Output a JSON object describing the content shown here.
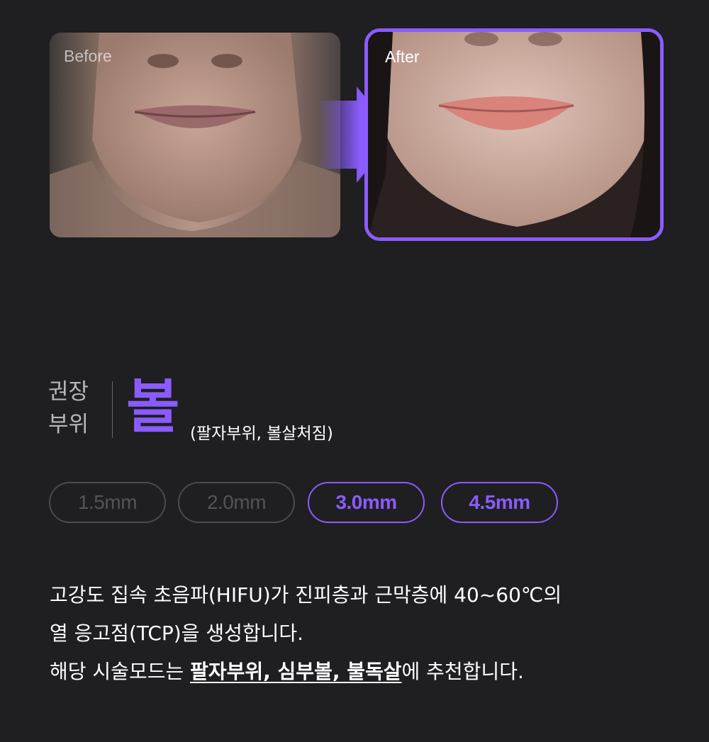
{
  "comparison": {
    "before_label": "Before",
    "after_label": "After"
  },
  "recommendation": {
    "label_line1": "권장",
    "label_line2": "부위",
    "area": "볼",
    "area_detail": "(팔자부위, 볼살처짐)"
  },
  "depths": [
    {
      "label": "1.5mm",
      "active": false
    },
    {
      "label": "2.0mm",
      "active": false
    },
    {
      "label": "3.0mm",
      "active": true
    },
    {
      "label": "4.5mm",
      "active": true
    }
  ],
  "description": {
    "line1": "고강도 집속 초음파(HIFU)가 진피층과 근막층에 40~60℃의",
    "line2": "열 응고점(TCP)을 생성합니다.",
    "line3_prefix": "해당 시술모드는 ",
    "line3_highlight": "팔자부위, 심부볼, 불독살",
    "line3_suffix": "에 추천합니다."
  },
  "colors": {
    "background": "#1f1e20",
    "accent": "#8a5cff",
    "inactive": "#545356"
  }
}
